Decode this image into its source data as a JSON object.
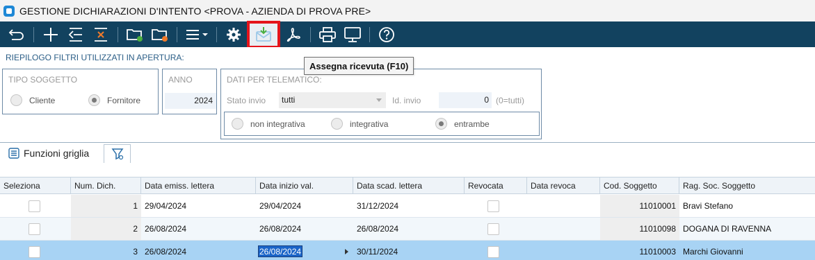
{
  "window": {
    "title": "GESTIONE DICHIARAZIONI D'INTENTO <PROVA - AZIENDA DI PROVA PRE>"
  },
  "toolbar": {
    "buttons": [
      {
        "name": "back",
        "icon": "undo-arrow-icon"
      },
      {
        "name": "new",
        "icon": "plus-icon"
      },
      {
        "name": "import",
        "icon": "list-arrow-icon"
      },
      {
        "name": "delete",
        "icon": "list-x-icon"
      },
      {
        "name": "open-folder-green",
        "icon": "folder-green-icon"
      },
      {
        "name": "open-folder-orange",
        "icon": "folder-orange-icon"
      },
      {
        "name": "menu",
        "icon": "menu-dropdown-icon"
      },
      {
        "name": "settings",
        "icon": "gear-icon"
      },
      {
        "name": "assign-receipt",
        "icon": "envelope-download-icon"
      },
      {
        "name": "pdf",
        "icon": "acrobat-icon"
      },
      {
        "name": "print",
        "icon": "printer-icon"
      },
      {
        "name": "preview",
        "icon": "monitor-icon"
      },
      {
        "name": "help",
        "icon": "question-icon"
      }
    ],
    "tooltip": "Assegna ricevuta (F10)"
  },
  "filters": {
    "title": "RIEPILOGO FILTRI UTILIZZATI IN APERTURA:",
    "tipo_soggetto": {
      "label": "TIPO SOGGETTO",
      "options": [
        {
          "label": "Cliente",
          "checked": false
        },
        {
          "label": "Fornitore",
          "checked": true
        }
      ]
    },
    "anno": {
      "label": "ANNO",
      "value": "2024"
    },
    "telematico": {
      "label": "DATI PER TELEMATICO:",
      "stato_invio_label": "Stato invio",
      "stato_invio_value": "tutti",
      "id_invio_label": "Id. invio",
      "id_invio_value": "0",
      "id_invio_hint": "(0=tutti)",
      "options": [
        {
          "label": "non integrativa",
          "checked": false
        },
        {
          "label": "integrativa",
          "checked": false
        },
        {
          "label": "entrambe",
          "checked": true
        }
      ]
    }
  },
  "grid_functions": {
    "label": "Funzioni griglia"
  },
  "grid": {
    "columns": [
      "Seleziona",
      "Num. Dich.",
      "Data emiss. lettera",
      "Data inizio val.",
      "Data scad. lettera",
      "Revocata",
      "Data revoca",
      "Cod. Soggetto",
      "Rag. Soc. Soggetto"
    ],
    "rows": [
      {
        "num": "1",
        "emiss": "29/04/2024",
        "inizio": "29/04/2024",
        "scad": "31/12/2024",
        "revoca": "",
        "cod": "11010001",
        "ragsoc": "Bravi Stefano",
        "selected": false
      },
      {
        "num": "2",
        "emiss": "26/08/2024",
        "inizio": "26/08/2024",
        "scad": "26/08/2024",
        "revoca": "",
        "cod": "11010098",
        "ragsoc": "DOGANA DI RAVENNA",
        "selected": false
      },
      {
        "num": "3",
        "emiss": "26/08/2024",
        "inizio": "26/08/2024",
        "scad": "30/11/2024",
        "revoca": "",
        "cod": "11010003",
        "ragsoc": "Marchi Giovanni",
        "selected": true
      }
    ]
  },
  "colors": {
    "toolbar_bg": "#12425f",
    "highlight_border": "#e4141b",
    "selected_row": "#a8d3f4",
    "group_border": "#6d8aa6"
  }
}
